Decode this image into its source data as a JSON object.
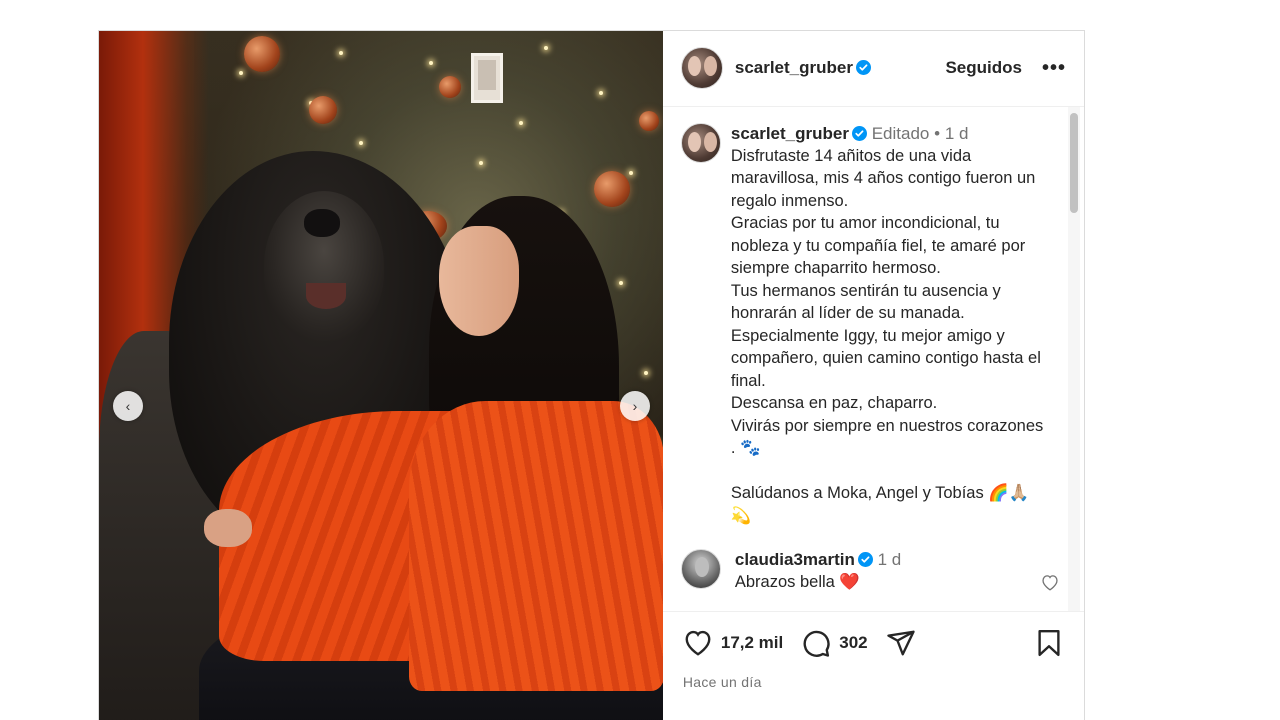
{
  "post": {
    "username": "scarlet_gruber",
    "follow_label": "Seguidos",
    "more_label": "•••",
    "nav": {
      "prev": "‹",
      "next": "›"
    }
  },
  "caption": {
    "username": "scarlet_gruber",
    "edited": "Editado",
    "separator": "•",
    "age": "1 d",
    "text": "Disfrutaste 14 añitos de una vida maravillosa, mis 4 años contigo fueron un regalo inmenso.\nGracias por tu amor incondicional, tu nobleza y tu compañía fiel, te amaré por siempre chaparrito hermoso.\nTus hermanos sentirán tu ausencia y honrarán al líder de su manada. Especialmente Iggy, tu mejor amigo y compañero, quien camino contigo hasta el final.\nDescansa en paz, chaparro.\nVivirás por siempre en nuestros corazones . 🐾\n\nSalúdanos a Moka, Angel y Tobías 🌈🙏🏼💫"
  },
  "comments": [
    {
      "username": "claudia3martin",
      "age": "1 d",
      "text": "Abrazos bella ❤️"
    }
  ],
  "actions": {
    "likes": "17,2 mil",
    "comments": "302",
    "timestamp": "Hace un día"
  },
  "colors": {
    "verified": "#0095f6",
    "text": "#262626",
    "muted": "#737373",
    "border": "#dbdbdb"
  },
  "icons": [
    "heart-icon",
    "comment-icon",
    "share-icon",
    "bookmark-icon",
    "verified-badge-icon",
    "more-icon",
    "chevron-left-icon",
    "chevron-right-icon"
  ]
}
